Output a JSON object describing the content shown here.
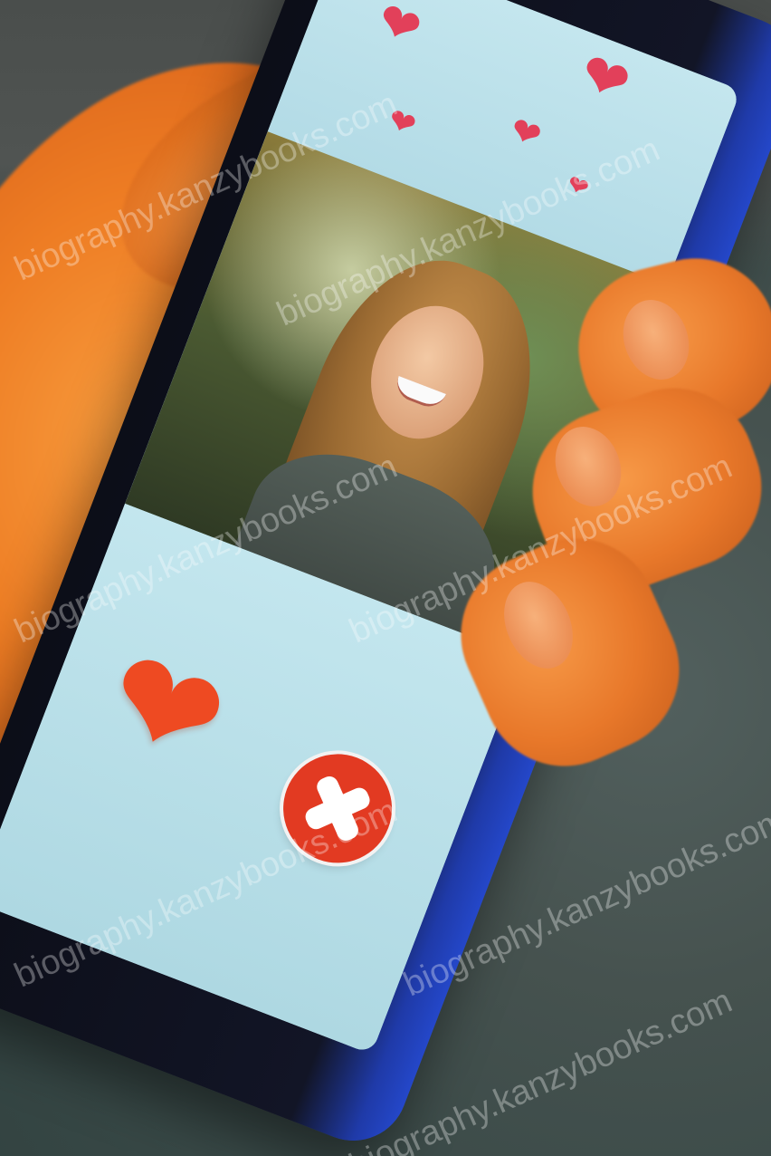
{
  "photo": {
    "subject": "hand holding a smartphone running a dating app"
  },
  "screen": {
    "top_hearts": [
      {
        "icon": "heart-icon",
        "color": "#e2405a"
      },
      {
        "icon": "heart-icon",
        "color": "#e2405a"
      },
      {
        "icon": "heart-icon",
        "color": "#e2405a"
      },
      {
        "icon": "heart-icon",
        "color": "#e2405a"
      },
      {
        "icon": "heart-icon",
        "color": "#e2405a"
      }
    ],
    "profile_photo": {
      "icon": "profile-photo"
    },
    "like_button": {
      "icon": "heart-icon",
      "glyph": "❤",
      "color": "#ee4a22"
    },
    "reject_button": {
      "icon": "close-icon",
      "color": "#e23a22"
    }
  },
  "watermarks": [
    "biography.kanzybooks.com",
    "biography.kanzybooks.com",
    "biography.kanzybooks.com",
    "biography.kanzybooks.com",
    "biography.kanzybooks.com",
    "biography.kanzybooks.com",
    "biography.kanzybooks.com"
  ]
}
